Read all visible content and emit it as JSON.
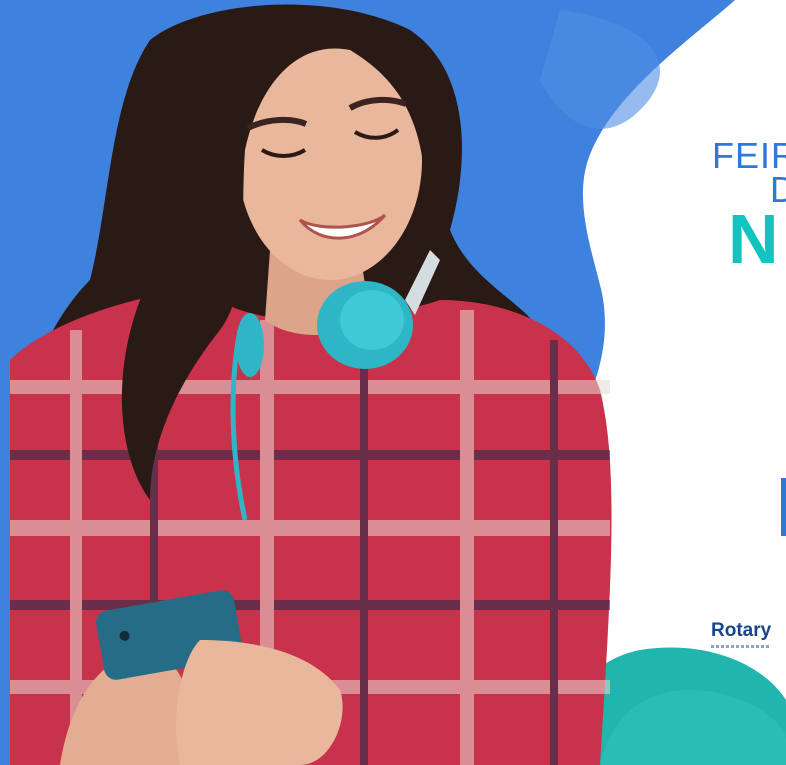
{
  "banner": {
    "headline_line1": "FEIR",
    "headline_line2": "D",
    "headline_line3": "N",
    "logo_text": "Rotary"
  },
  "photo": {
    "subject": "smiling-woman-with-headphones-and-smartphone"
  },
  "colors": {
    "blue_panel": "#3f82de",
    "blue_text": "#2f78d8",
    "teal_text": "#12c4c0",
    "teal_shape": "#20b5ad",
    "logo_navy": "#17458f",
    "shirt_red": "#c8324a",
    "hair": "#2a1a16",
    "skin": "#e9b79c",
    "headphones": "#2fb6c6",
    "phone": "#256d86"
  }
}
